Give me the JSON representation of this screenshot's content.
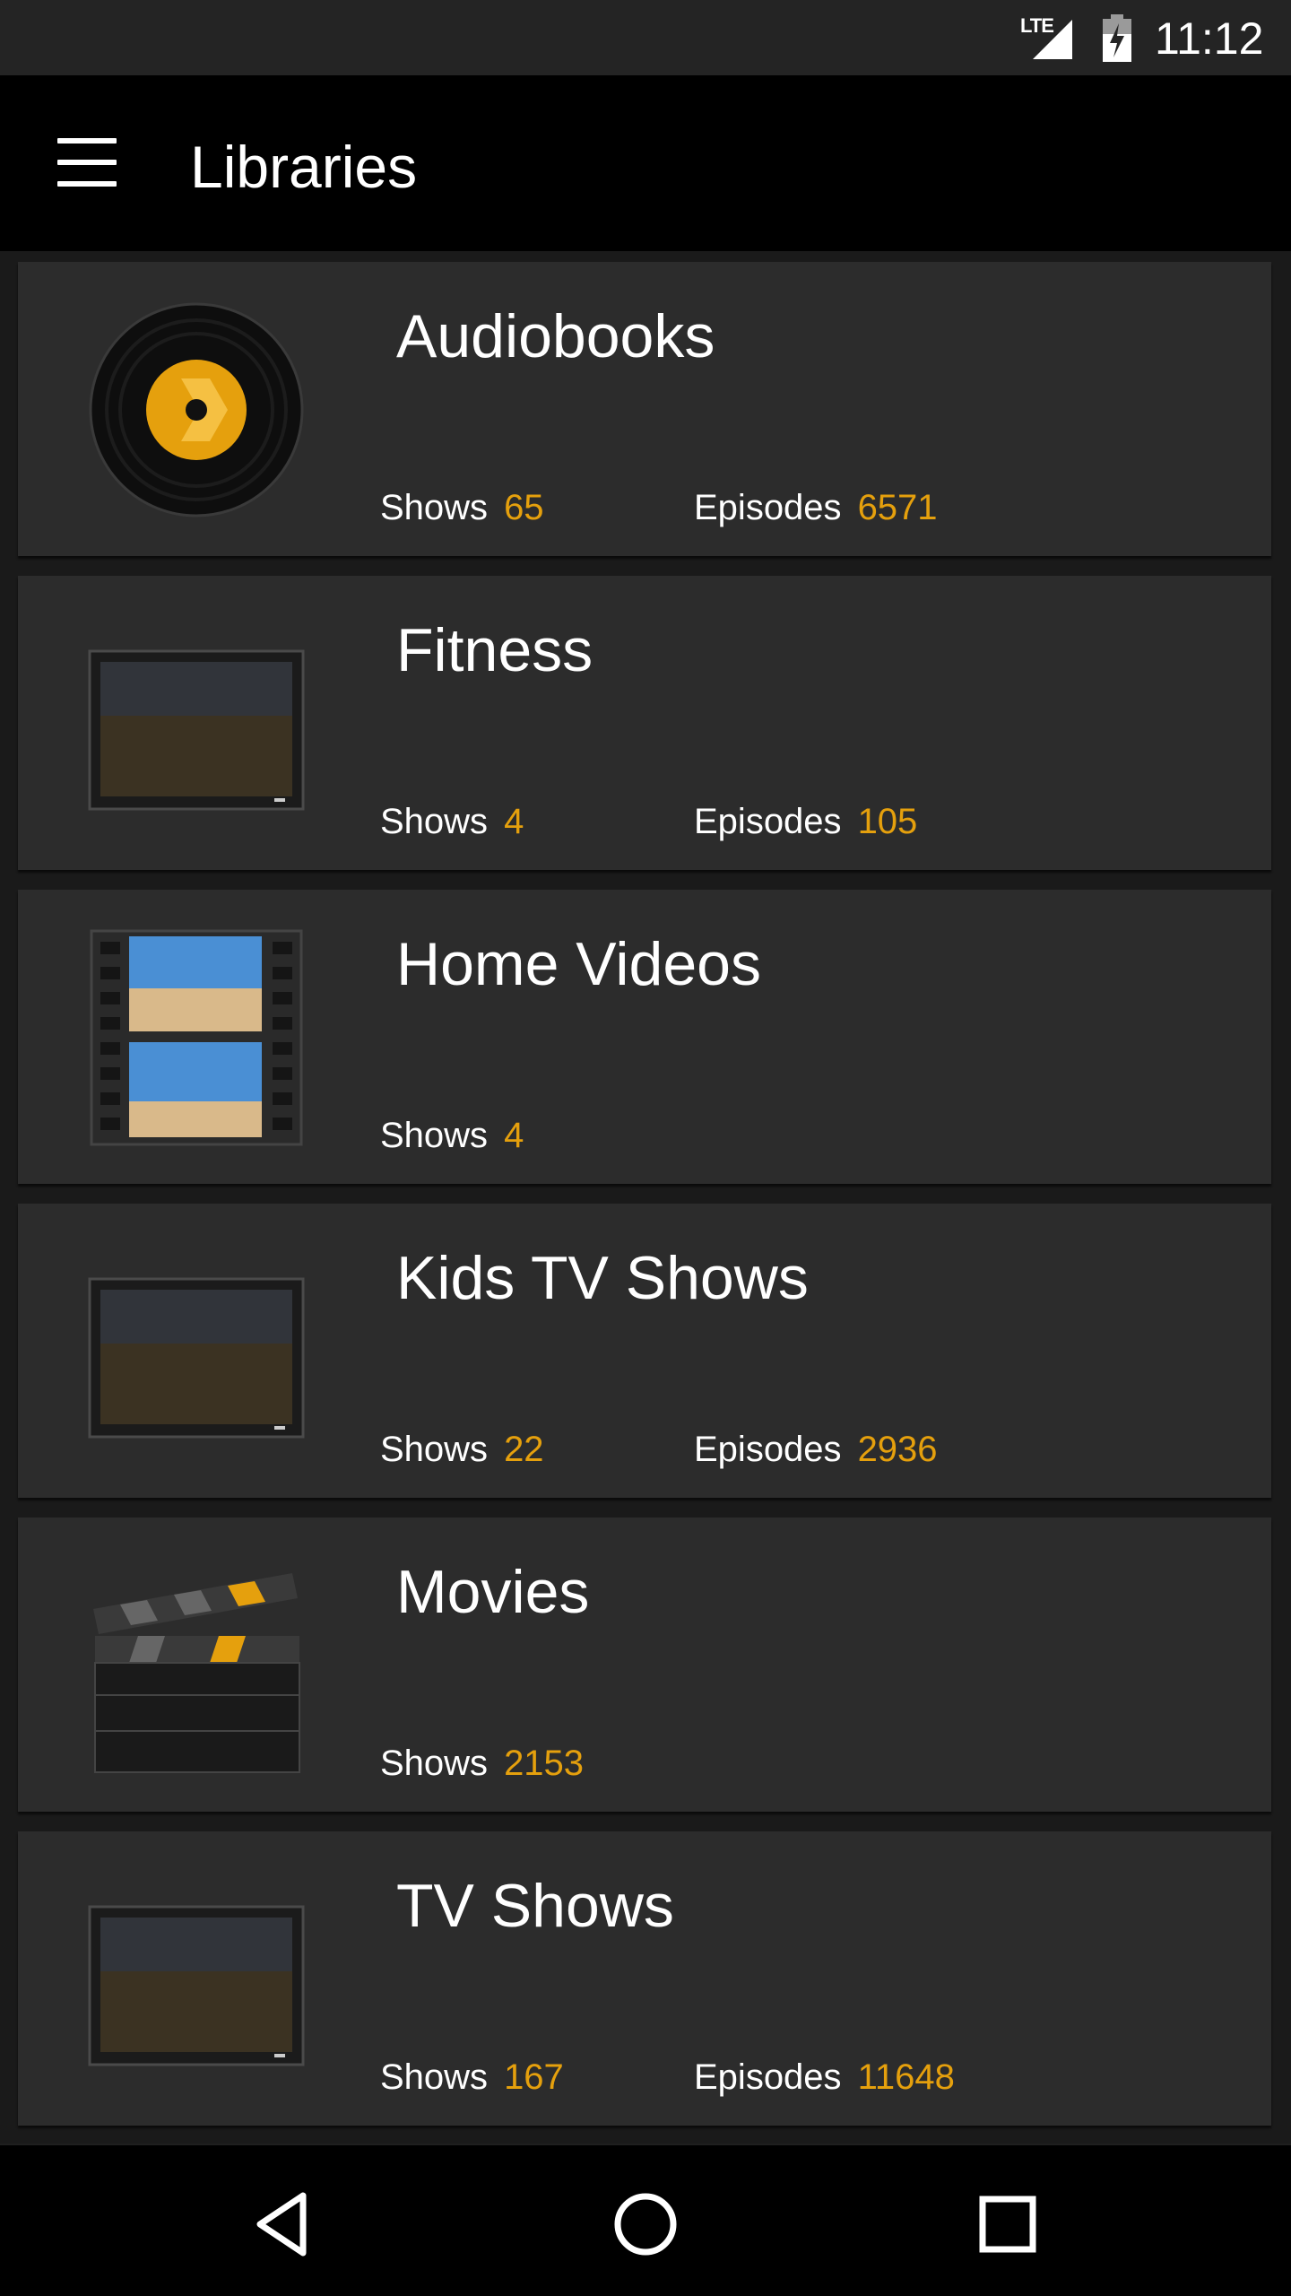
{
  "status_bar": {
    "network": "LTE",
    "time": "11:12"
  },
  "toolbar": {
    "title": "Libraries",
    "menu_icon": "menu-icon"
  },
  "libraries": [
    {
      "name": "Audiobooks",
      "icon": "vinyl-record-icon",
      "shows_label": "Shows",
      "shows": "65",
      "episodes_label": "Episodes",
      "episodes": "6571"
    },
    {
      "name": "Fitness",
      "icon": "tv-screen-icon",
      "shows_label": "Shows",
      "shows": "4",
      "episodes_label": "Episodes",
      "episodes": "105"
    },
    {
      "name": "Home Videos",
      "icon": "film-strip-icon",
      "shows_label": "Shows",
      "shows": "4"
    },
    {
      "name": "Kids TV Shows",
      "icon": "tv-screen-icon",
      "shows_label": "Shows",
      "shows": "22",
      "episodes_label": "Episodes",
      "episodes": "2936"
    },
    {
      "name": "Movies",
      "icon": "clapperboard-icon",
      "shows_label": "Shows",
      "shows": "2153"
    },
    {
      "name": "TV Shows",
      "icon": "tv-screen-icon",
      "shows_label": "Shows",
      "shows": "167",
      "episodes_label": "Episodes",
      "episodes": "11648"
    }
  ],
  "colors": {
    "accent": "#e5a00d",
    "card": "#2c2c2c",
    "toolbar": "#000000"
  },
  "nav_bar": {
    "back_icon": "back-triangle-icon",
    "home_icon": "home-circle-icon",
    "recents_icon": "recents-square-icon"
  }
}
